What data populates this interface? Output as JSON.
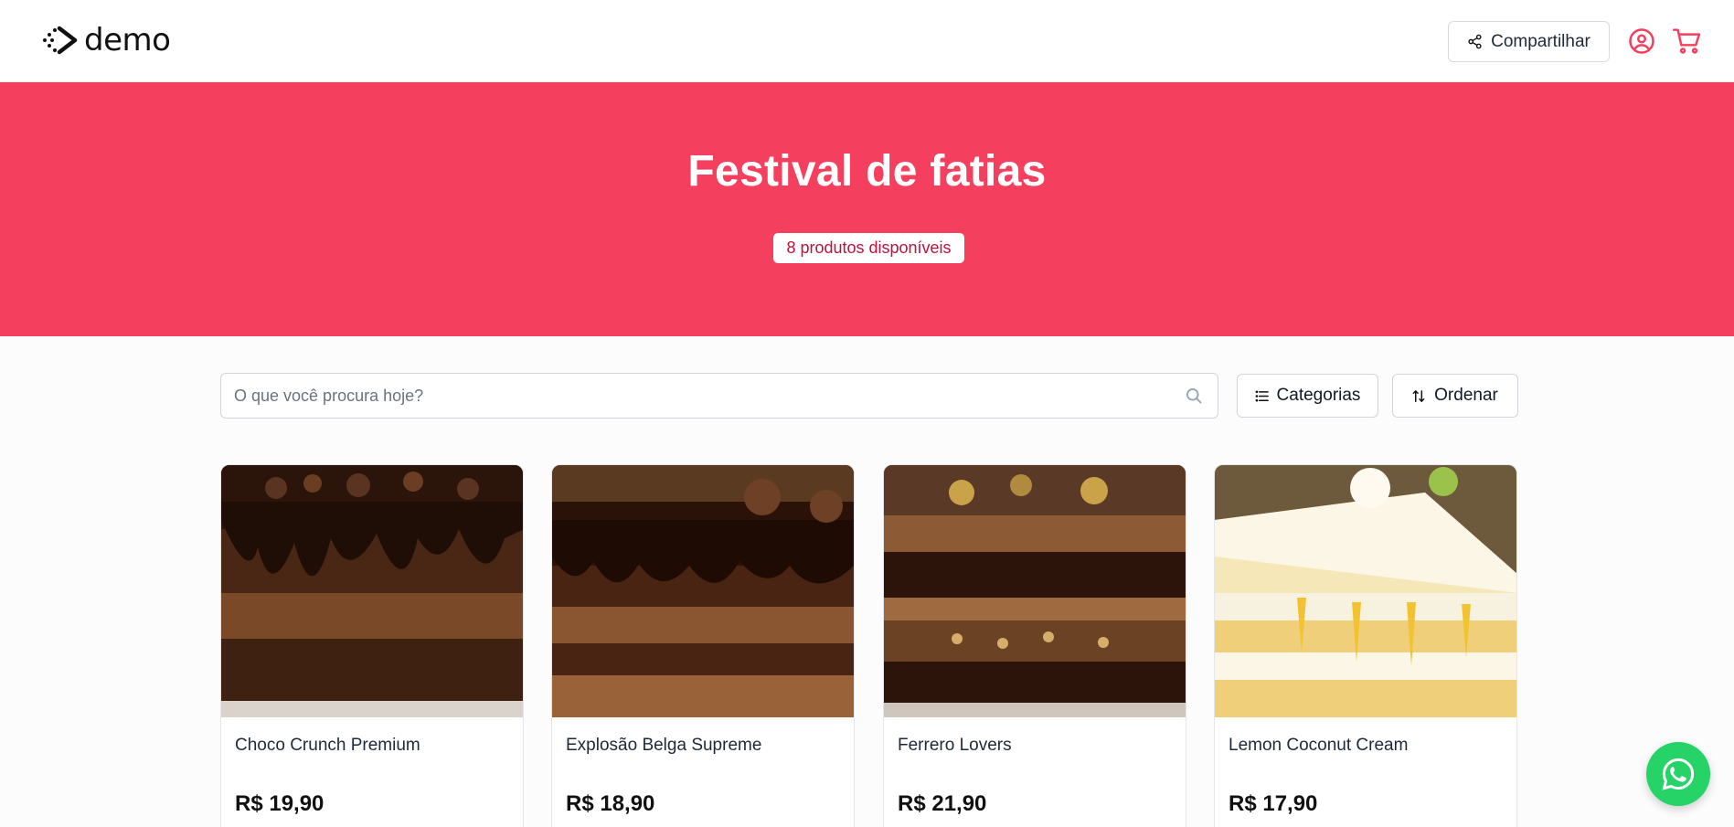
{
  "header": {
    "logo_text": "demo",
    "share_label": "Compartilhar"
  },
  "hero": {
    "title": "Festival de fatias",
    "badge": "8 produtos disponíveis"
  },
  "search": {
    "placeholder": "O que você procura hoje?"
  },
  "toolbar": {
    "categories_label": "Categorias",
    "sort_label": "Ordenar"
  },
  "products": [
    {
      "name": "Choco Crunch Premium",
      "price": "R$ 19,90"
    },
    {
      "name": "Explosão Belga Supreme",
      "price": "R$ 18,90"
    },
    {
      "name": "Ferrero Lovers",
      "price": "R$ 21,90"
    },
    {
      "name": "Lemon Coconut Cream",
      "price": "R$ 17,90"
    }
  ],
  "colors": {
    "accent": "#f43f5e",
    "badge_text": "#be123c",
    "whatsapp": "#25d366"
  },
  "icons": [
    "logo-icon",
    "share-icon",
    "user-circle-icon",
    "cart-icon",
    "search-icon",
    "list-icon",
    "sort-icon",
    "whatsapp-icon"
  ]
}
